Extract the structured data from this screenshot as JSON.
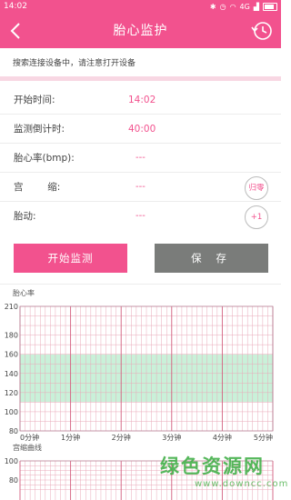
{
  "status_bar": {
    "time": "14:02",
    "signal": "4G",
    "wifi": "wifi",
    "battery": "battery-icon"
  },
  "header": {
    "title": "胎心监护",
    "back_icon": "chevron-left-icon",
    "history_icon": "history-clock-icon"
  },
  "hint": "搜索连接设备中，请注意打开设备",
  "rows": {
    "start_time": {
      "label": "开始时间:",
      "value": "14:02"
    },
    "countdown": {
      "label": "监测倒计时:",
      "value": "40:00"
    },
    "heart_rate": {
      "label": "胎心率(bmp):",
      "value": "---"
    },
    "contraction": {
      "label": "宫        缩:",
      "value": "---",
      "button": "归零"
    },
    "movement": {
      "label": "胎动:",
      "value": "---",
      "button": "+1"
    }
  },
  "buttons": {
    "start": "开始监测",
    "save": "保 存"
  },
  "charts": {
    "heart_rate_title": "胎心率",
    "contraction_title": "宫缩曲线"
  },
  "watermark": {
    "main": "绿色资源网",
    "sub": "www.downcc.com"
  },
  "colors": {
    "brand": "#f2528e",
    "band": "#c9f1d9",
    "grid": "#e9a9b9",
    "save": "#7a7c7a"
  },
  "chart_data": [
    {
      "type": "line",
      "title": "胎心率",
      "x_ticks": [
        "0分钟",
        "1分钟",
        "2分钟",
        "3分钟",
        "4分钟",
        "5分钟"
      ],
      "xlim": [
        0,
        5
      ],
      "y_ticks": [
        80,
        100,
        120,
        140,
        160,
        180,
        210
      ],
      "ylim": [
        80,
        210
      ],
      "normal_band": [
        110,
        160
      ],
      "series": [],
      "grid": true
    },
    {
      "type": "line",
      "title": "宫缩曲线",
      "y_ticks": [
        100,
        80
      ],
      "ylim_visible": [
        70,
        100
      ],
      "series": [],
      "grid": true
    }
  ]
}
